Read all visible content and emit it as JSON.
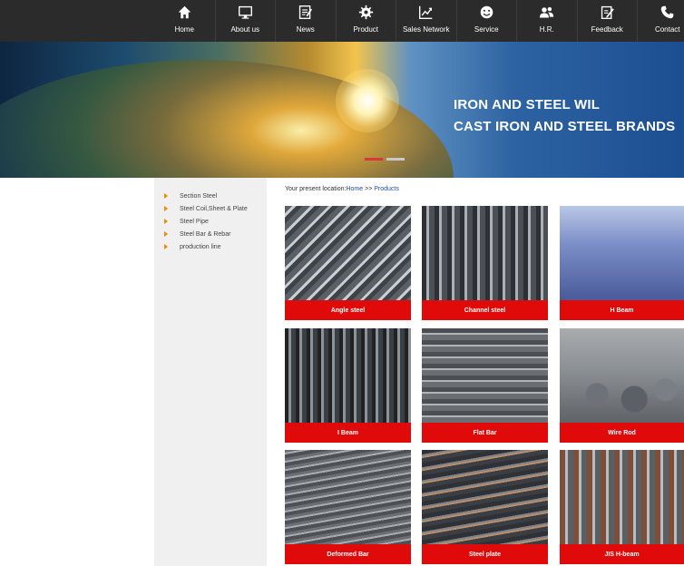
{
  "nav": {
    "items": [
      {
        "label": "Home",
        "icon": "home-icon"
      },
      {
        "label": "About us",
        "icon": "monitor-icon"
      },
      {
        "label": "News",
        "icon": "news-icon"
      },
      {
        "label": "Product",
        "icon": "gear-icon"
      },
      {
        "label": "Sales Network",
        "icon": "chart-icon"
      },
      {
        "label": "Service",
        "icon": "smiley-icon"
      },
      {
        "label": "H.R.",
        "icon": "users-icon"
      },
      {
        "label": "Feedback",
        "icon": "edit-icon"
      },
      {
        "label": "Contact",
        "icon": "phone-icon"
      }
    ]
  },
  "banner": {
    "line1": "IRON AND STEEL WIL",
    "line2": "CAST IRON AND STEEL BRANDS"
  },
  "sidebar": {
    "items": [
      {
        "label": "Section Steel"
      },
      {
        "label": "Steel Coil,Sheet & Plate"
      },
      {
        "label": "Steel Pipe"
      },
      {
        "label": "Steel Bar & Rebar"
      },
      {
        "label": "production line"
      }
    ]
  },
  "breadcrumb": {
    "prefix": "Your present location:",
    "home": "Home",
    "sep": " >> ",
    "current": "Products"
  },
  "products": [
    {
      "label": "Angle steel"
    },
    {
      "label": "Channel steel"
    },
    {
      "label": "H Beam"
    },
    {
      "label": "I Beam"
    },
    {
      "label": "Flat Bar"
    },
    {
      "label": "Wire Rod"
    },
    {
      "label": "Deformed Bar"
    },
    {
      "label": "Steel plate"
    },
    {
      "label": "JIS H-beam"
    }
  ]
}
